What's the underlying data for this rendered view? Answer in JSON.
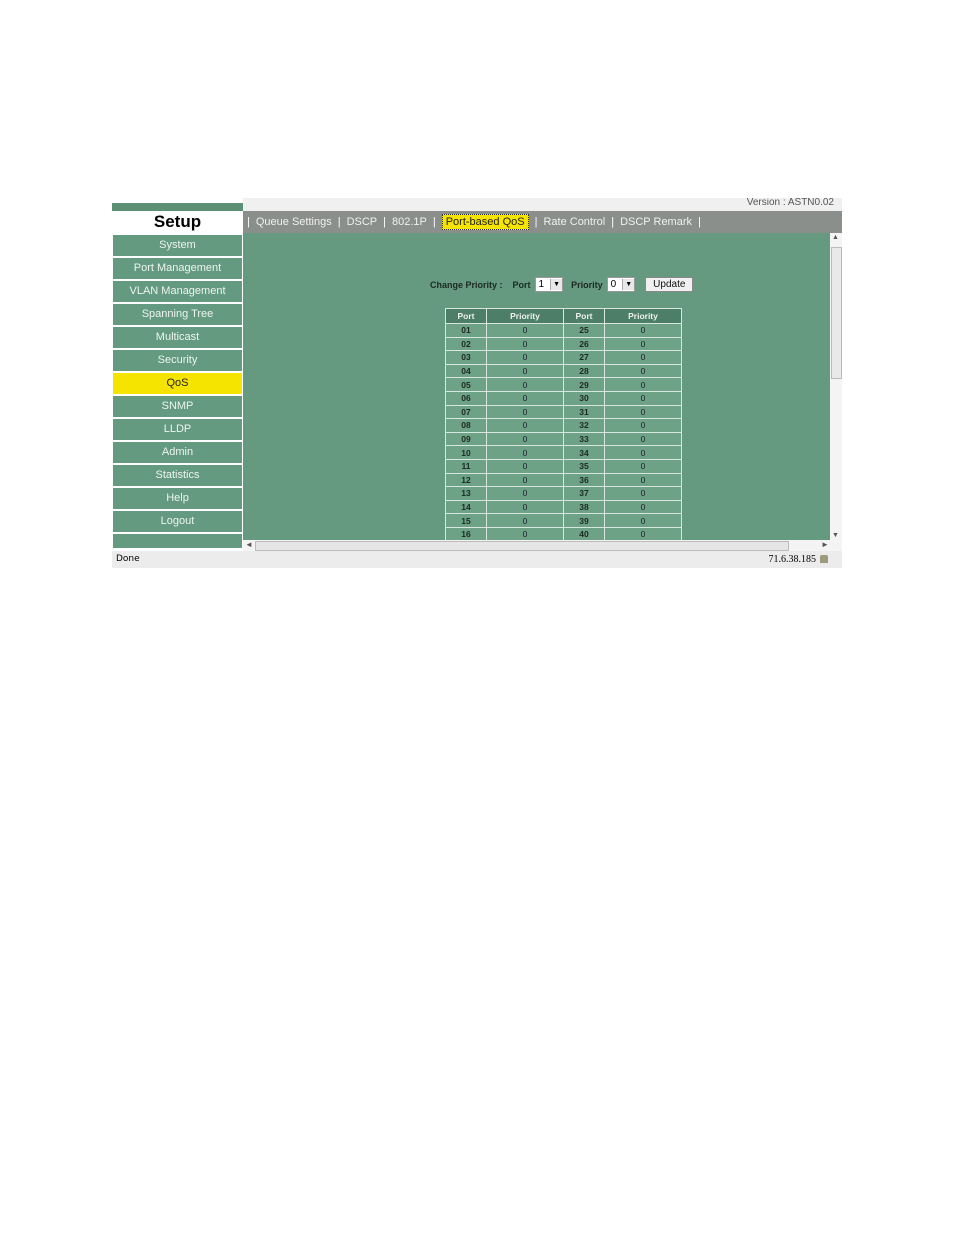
{
  "header": {
    "version": "Version : ASTN0.02"
  },
  "sidebar": {
    "title": "Setup",
    "items": [
      {
        "label": "System"
      },
      {
        "label": "Port Management"
      },
      {
        "label": "VLAN Management"
      },
      {
        "label": "Spanning Tree"
      },
      {
        "label": "Multicast"
      },
      {
        "label": "Security"
      },
      {
        "label": "QoS",
        "active": true
      },
      {
        "label": "SNMP"
      },
      {
        "label": "LLDP"
      },
      {
        "label": "Admin"
      },
      {
        "label": "Statistics"
      },
      {
        "label": "Help"
      },
      {
        "label": "Logout"
      }
    ]
  },
  "tabs": [
    {
      "label": "Queue Settings"
    },
    {
      "label": "DSCP"
    },
    {
      "label": "802.1P"
    },
    {
      "label": "Port-based QoS",
      "active": true
    },
    {
      "label": "Rate Control"
    },
    {
      "label": "DSCP Remark"
    }
  ],
  "change_priority": {
    "label": "Change Priority :",
    "port_label": "Port",
    "port_value": "1",
    "priority_label": "Priority",
    "priority_value": "0",
    "update_label": "Update"
  },
  "table": {
    "headers": [
      "Port",
      "Priority",
      "Port",
      "Priority"
    ],
    "rows": [
      [
        "01",
        "0",
        "25",
        "0"
      ],
      [
        "02",
        "0",
        "26",
        "0"
      ],
      [
        "03",
        "0",
        "27",
        "0"
      ],
      [
        "04",
        "0",
        "28",
        "0"
      ],
      [
        "05",
        "0",
        "29",
        "0"
      ],
      [
        "06",
        "0",
        "30",
        "0"
      ],
      [
        "07",
        "0",
        "31",
        "0"
      ],
      [
        "08",
        "0",
        "32",
        "0"
      ],
      [
        "09",
        "0",
        "33",
        "0"
      ],
      [
        "10",
        "0",
        "34",
        "0"
      ],
      [
        "11",
        "0",
        "35",
        "0"
      ],
      [
        "12",
        "0",
        "36",
        "0"
      ],
      [
        "13",
        "0",
        "37",
        "0"
      ],
      [
        "14",
        "0",
        "38",
        "0"
      ],
      [
        "15",
        "0",
        "39",
        "0"
      ],
      [
        "16",
        "0",
        "40",
        "0"
      ]
    ]
  },
  "status": {
    "left": "Done",
    "right": "71.6.38.185"
  },
  "colors": {
    "accent": "#f5e400",
    "panel": "#659a80",
    "nav": "#649a80",
    "tabbar": "#8a8f8b"
  }
}
